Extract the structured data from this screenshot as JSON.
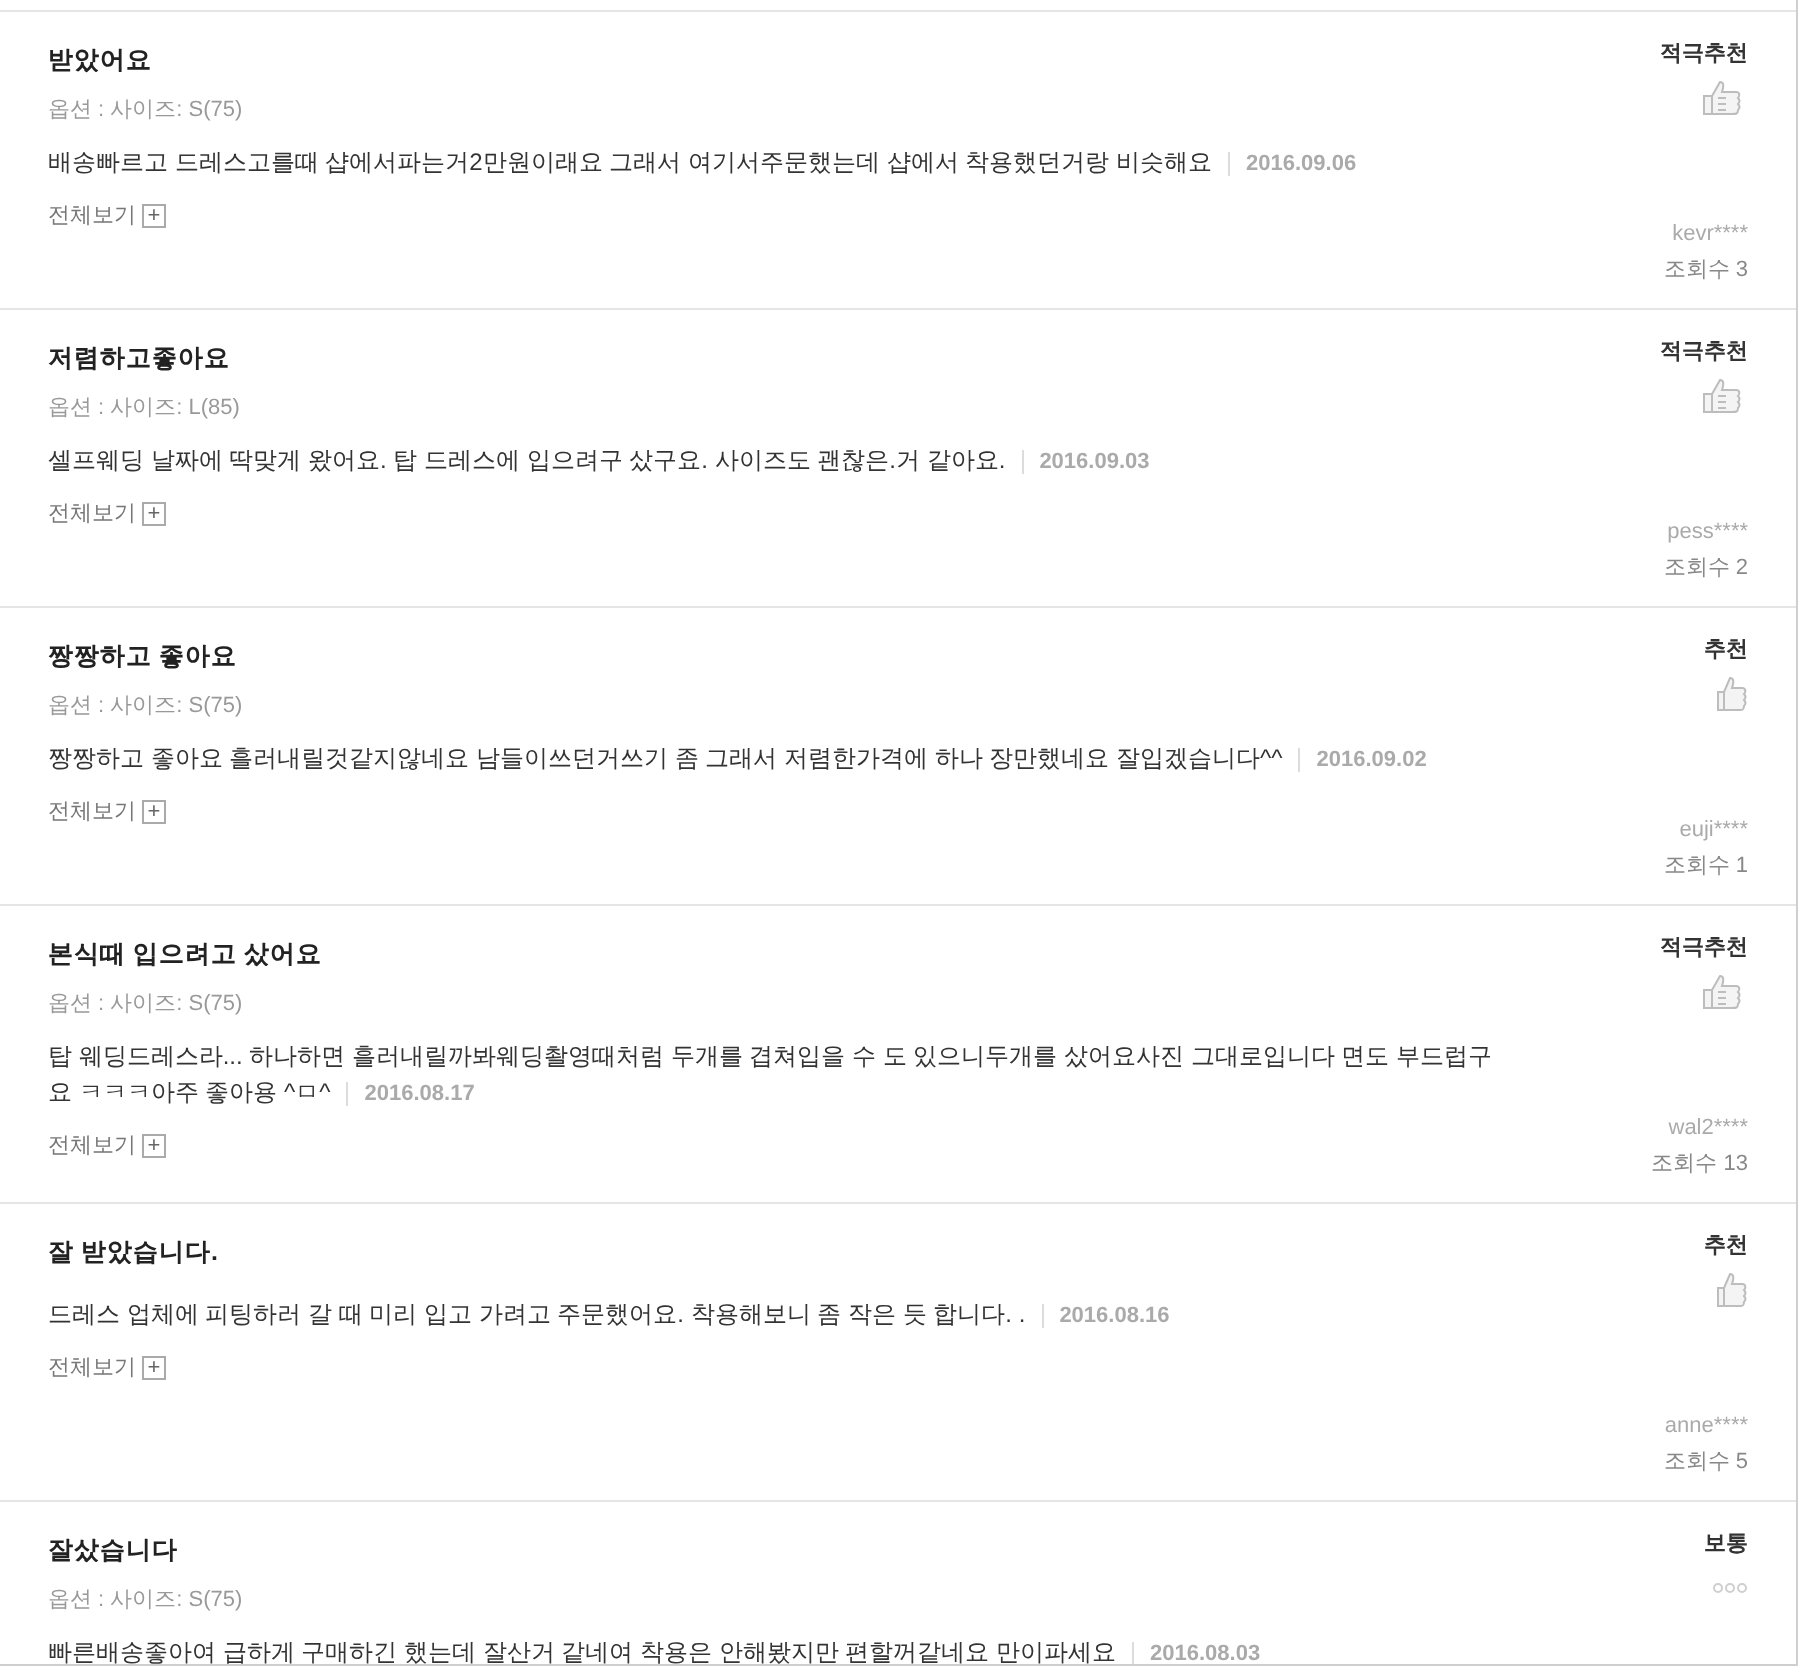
{
  "reviews": [
    {
      "title": "받았어요",
      "option": "옵션 : 사이즈: S(75)",
      "body": "배송빠르고 드레스고를때 샵에서파는거2만원이래요 그래서 여기서주문했는데 샵에서 착용했던거랑 비슷해요",
      "date": "2016.09.06",
      "more": "전체보기",
      "more_icon": "+",
      "rating": {
        "label": "적극추천",
        "kind": "strong"
      },
      "user": "kevr****",
      "views": "조회수 3"
    },
    {
      "title": "저렴하고좋아요",
      "option": "옵션 : 사이즈: L(85)",
      "body": "셀프웨딩 날짜에 딱맞게 왔어요. 탑 드레스에 입으려구 샀구요. 사이즈도 괜찮은.거 같아요.",
      "date": "2016.09.03",
      "more": "전체보기",
      "more_icon": "+",
      "rating": {
        "label": "적극추천",
        "kind": "strong"
      },
      "user": "pess****",
      "views": "조회수 2"
    },
    {
      "title": "짱짱하고 좋아요",
      "option": "옵션 : 사이즈: S(75)",
      "body": "짱짱하고 좋아요 흘러내릴것같지않네요 남들이쓰던거쓰기 좀 그래서 저렴한가격에 하나 장만했네요 잘입겠습니다^^",
      "date": "2016.09.02",
      "more": "전체보기",
      "more_icon": "+",
      "rating": {
        "label": "추천",
        "kind": "up"
      },
      "user": "euji****",
      "views": "조회수 1"
    },
    {
      "title": "본식때 입으려고 샀어요",
      "option": "옵션 : 사이즈: S(75)",
      "body": "탑 웨딩드레스라... 하나하면 흘러내릴까봐웨딩촬영때처럼 두개를 겹쳐입을 수 도 있으니두개를 샀어요사진 그대로입니다 면도 부드럽구요 ㅋㅋㅋ아주 좋아용 ^ㅁ^",
      "date": "2016.08.17",
      "more": "전체보기",
      "more_icon": "+",
      "rating": {
        "label": "적극추천",
        "kind": "strong"
      },
      "user": "wal2****",
      "views": "조회수 13"
    },
    {
      "title": "잘 받았습니다.",
      "body": "드레스 업체에 피팅하러 갈 때 미리 입고 가려고 주문했어요. 착용해보니 좀 작은 듯 합니다. .",
      "date": "2016.08.16",
      "more": "전체보기",
      "more_icon": "+",
      "rating": {
        "label": "추천",
        "kind": "up"
      },
      "user": "anne****",
      "views": "조회수 5"
    },
    {
      "title": "잘샀습니다",
      "option": "옵션 : 사이즈: S(75)",
      "body": "빠른배송좋아여 급하게 구매하긴 했는데 잘산거 같네여 착용은 안해봤지만 편할꺼같네요 만이파세요",
      "date": "2016.08.03",
      "rating": {
        "label": "보통",
        "kind": "neutral"
      }
    }
  ]
}
